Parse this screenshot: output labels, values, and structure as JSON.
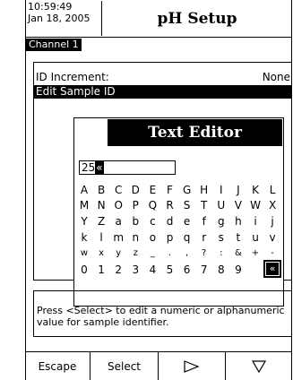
{
  "header": {
    "time": "10:59:49",
    "date": "Jan 18, 2005",
    "title": "pH Setup"
  },
  "channel_tab": "Channel 1",
  "menu": {
    "items": [
      {
        "label": "ID Increment:",
        "value": "None",
        "selected": false
      },
      {
        "label": "Edit Sample ID",
        "value": "",
        "selected": true
      }
    ]
  },
  "text_editor": {
    "title": "Text Editor",
    "field_value": "25",
    "cursor_glyph": "«",
    "rows": [
      [
        "A",
        "B",
        "C",
        "D",
        "E",
        "F",
        "G",
        "H",
        "I",
        "J",
        "K",
        "L"
      ],
      [
        "M",
        "N",
        "O",
        "P",
        "Q",
        "R",
        "S",
        "T",
        "U",
        "V",
        "W",
        "X"
      ],
      [
        "Y",
        "Z",
        "a",
        "b",
        "c",
        "d",
        "e",
        "f",
        "g",
        "h",
        "i",
        "j"
      ],
      [
        "k",
        "l",
        "m",
        "n",
        "o",
        "p",
        "q",
        "r",
        "s",
        "t",
        "u",
        "v"
      ],
      [
        "w",
        "x",
        "y",
        "z",
        "_",
        ".",
        ",",
        "?",
        ":",
        "&",
        "+",
        "-"
      ],
      [
        "0",
        "1",
        "2",
        "3",
        "4",
        "5",
        "6",
        "7",
        "8",
        "9",
        "",
        "«"
      ]
    ]
  },
  "help_text": "Press <Select> to edit a numeric or alphanumeric value for sample identifier.",
  "softkeys": {
    "escape": "Escape",
    "select": "Select",
    "right_icon": "play-right-icon",
    "down_icon": "triangle-down-icon"
  }
}
